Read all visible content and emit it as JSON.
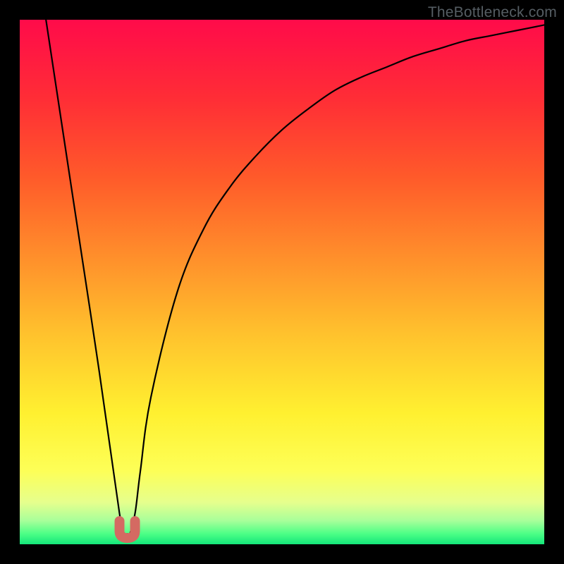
{
  "watermark": "TheBottleneck.com",
  "chart_data": {
    "type": "line",
    "title": "",
    "xlabel": "",
    "ylabel": "",
    "xlim": [
      0,
      100
    ],
    "ylim": [
      0,
      100
    ],
    "x": [
      5,
      10,
      15,
      19,
      20,
      21,
      22,
      23,
      25,
      30,
      35,
      40,
      45,
      50,
      55,
      60,
      65,
      70,
      75,
      80,
      85,
      90,
      95,
      100
    ],
    "values": [
      100,
      67,
      34,
      6,
      2,
      2,
      6,
      14,
      28,
      48,
      60,
      68,
      74,
      79,
      83,
      86.5,
      89,
      91,
      93,
      94.5,
      96,
      97,
      98,
      99
    ],
    "cusp_x": 20.5,
    "cusp_y": 2,
    "gradient_stops": [
      {
        "pos": 0.0,
        "color": "#ff0b4a"
      },
      {
        "pos": 0.15,
        "color": "#ff2d36"
      },
      {
        "pos": 0.3,
        "color": "#ff5a2a"
      },
      {
        "pos": 0.45,
        "color": "#ff8e2b"
      },
      {
        "pos": 0.6,
        "color": "#ffc22d"
      },
      {
        "pos": 0.75,
        "color": "#fff030"
      },
      {
        "pos": 0.86,
        "color": "#fdff57"
      },
      {
        "pos": 0.92,
        "color": "#e6ff8d"
      },
      {
        "pos": 0.955,
        "color": "#a8ff9a"
      },
      {
        "pos": 0.98,
        "color": "#4cff86"
      },
      {
        "pos": 1.0,
        "color": "#14e67a"
      }
    ],
    "cusp_marker_color": "#d46a62",
    "curve_color": "#000000"
  }
}
